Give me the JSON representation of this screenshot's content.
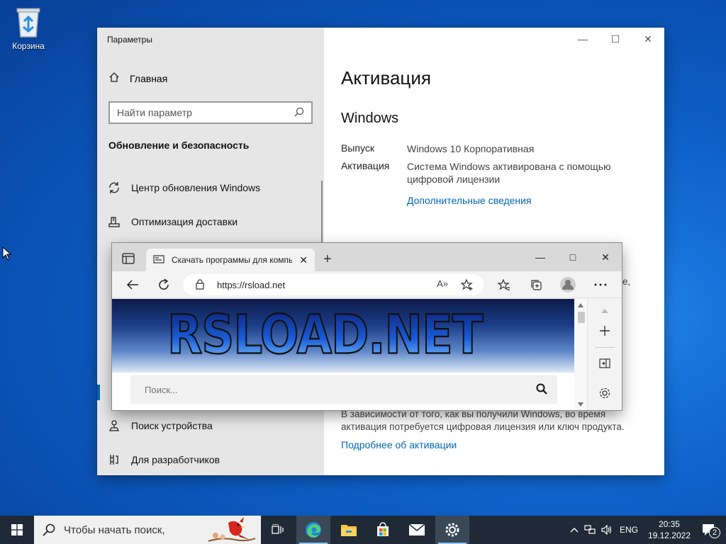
{
  "desktop": {
    "recycle_bin_label": "Корзина"
  },
  "settings": {
    "window_title": "Параметры",
    "home_label": "Главная",
    "search_placeholder": "Найти параметр",
    "section_title": "Обновление и безопасность",
    "nav": [
      {
        "label": "Центр обновления Windows",
        "icon": "refresh-icon"
      },
      {
        "label": "Оптимизация доставки",
        "icon": "delivery-icon"
      },
      {
        "label": "Поиск устройства",
        "icon": "find-device-icon"
      },
      {
        "label": "Для разработчиков",
        "icon": "developer-icon"
      }
    ],
    "page_title": "Активация",
    "sub_title": "Windows",
    "edition_label": "Выпуск",
    "edition_value": "Windows 10 Корпоративная",
    "activation_label": "Активация",
    "activation_value": "Система Windows активирована с помощью цифровой лицензии",
    "more_info_link": "Дополнительные сведения",
    "partial_text": "ве,",
    "description": "В зависимости от того, как вы получили Windows, во время активация потребуется цифровая лицензия или ключ продукта.",
    "activation_link": "Подробнее об активации"
  },
  "edge": {
    "tab_title": "Скачать программы для компьютера",
    "url": "https://rsload.net",
    "read_aloud": "A»",
    "site_logo": "RSLOAD.NET",
    "site_search_placeholder": "Поиск..."
  },
  "taskbar": {
    "search_placeholder": "Чтобы начать поиск,",
    "language": "ENG",
    "time": "20:35",
    "date": "19.12.2022",
    "notifications_count": "2"
  },
  "colors": {
    "accent": "#0067b8",
    "taskbar": "#1f2a36",
    "settings_sidebar": "#e6e6e6"
  }
}
